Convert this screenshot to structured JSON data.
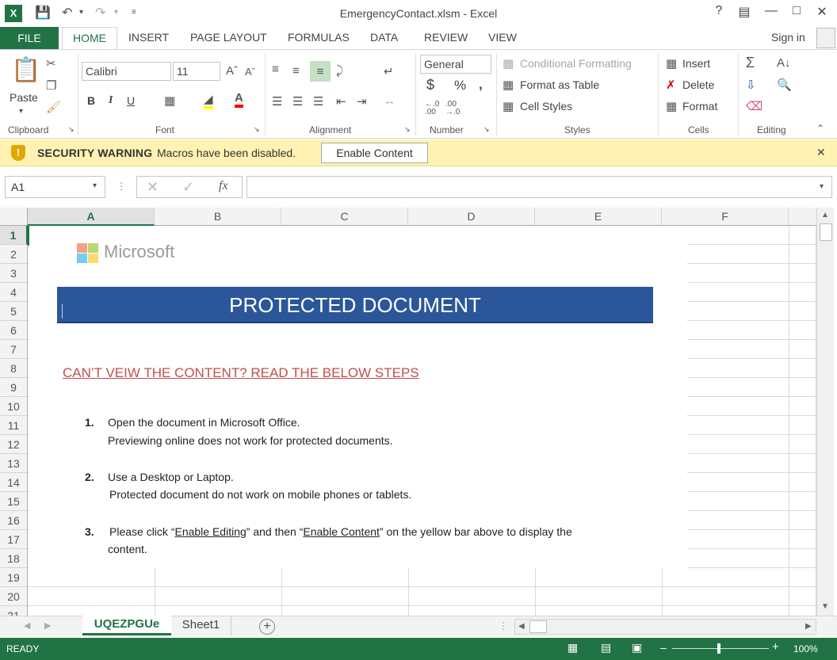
{
  "title": "EmergencyContact.xlsm - Excel",
  "tabs": [
    "FILE",
    "HOME",
    "INSERT",
    "PAGE LAYOUT",
    "FORMULAS",
    "DATA",
    "REVIEW",
    "VIEW"
  ],
  "sign_in": "Sign in",
  "ribbon": {
    "clipboard": {
      "paste": "Paste",
      "label": "Clipboard"
    },
    "font": {
      "name": "Calibri",
      "size": "11",
      "bold": "B",
      "italic": "I",
      "underline": "U",
      "label": "Font"
    },
    "alignment": {
      "label": "Alignment"
    },
    "number": {
      "format": "General",
      "currency": "$",
      "percent": "%",
      "comma": ",",
      "label": "Number"
    },
    "styles": {
      "conditional": "Conditional Formatting",
      "format_table": "Format as Table",
      "cell_styles": "Cell Styles",
      "label": "Styles"
    },
    "cells": {
      "insert": "Insert",
      "delete": "Delete",
      "format": "Format",
      "label": "Cells"
    },
    "editing": {
      "label": "Editing"
    }
  },
  "security": {
    "title": "SECURITY WARNING",
    "message": "Macros have been disabled.",
    "button": "Enable Content"
  },
  "formula_bar": {
    "name_box": "A1",
    "fx": "fx",
    "value": ""
  },
  "columns": [
    "A",
    "B",
    "C",
    "D",
    "E",
    "F"
  ],
  "rows": [
    "1",
    "2",
    "3",
    "4",
    "5",
    "6",
    "7",
    "8",
    "9",
    "10",
    "11",
    "12",
    "13",
    "14",
    "15",
    "16",
    "17",
    "18",
    "19",
    "20",
    "21"
  ],
  "document": {
    "logo_text": "Microsoft",
    "banner": "PROTECTED DOCUMENT",
    "heading": "CAN’T VEIW THE CONTENT? READ THE BELOW STEPS",
    "steps": [
      {
        "num": "1.",
        "line1": "Open the document in Microsoft Office.",
        "line2": "Previewing online does not work for protected documents."
      },
      {
        "num": "2.",
        "line1": "Use a Desktop or Laptop.",
        "line2": "Protected document do not work on mobile phones or tablets."
      },
      {
        "num": "3.",
        "pre": "Please click ",
        "q1": "“",
        "link1": "Enable Editing",
        "mid": "” and then “",
        "link2": "Enable Content",
        "post": "” on the yellow bar above to display the",
        "line2": "content."
      }
    ]
  },
  "sheets": [
    "UQEZPGUe",
    "Sheet1"
  ],
  "status": {
    "ready": "READY",
    "zoom": "100%"
  },
  "colors": {
    "excel_green": "#217346",
    "banner_blue": "#2b579a",
    "warning_yellow": "#fff2b3",
    "heading_red": "#c0504d"
  }
}
